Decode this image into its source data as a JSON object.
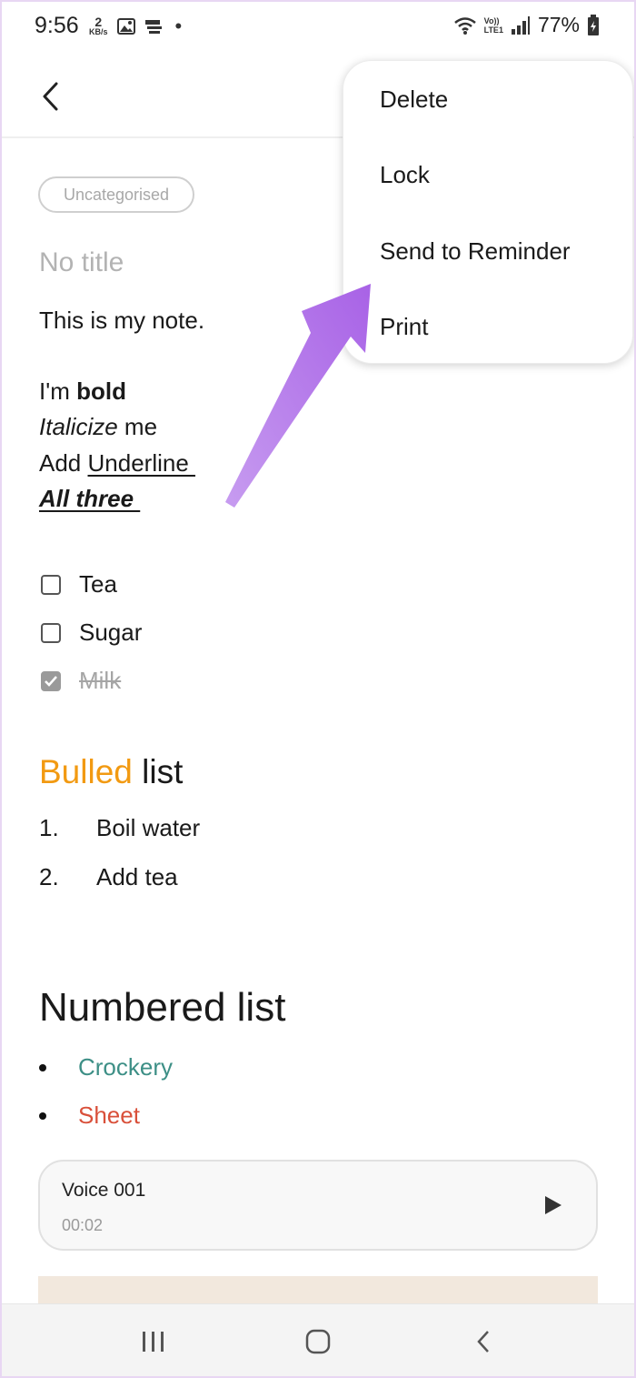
{
  "status_bar": {
    "time": "9:56",
    "data_speed_value": "2",
    "data_speed_unit": "KB/s",
    "battery": "77%",
    "network_label_top": "Vo))",
    "network_label_bottom": "LTE1"
  },
  "note": {
    "category": "Uncategorised",
    "title_placeholder": "No title",
    "body_line": "This is my note.",
    "format_lines": {
      "bold_prefix": "I'm ",
      "bold_word": "bold",
      "italic_word": "Italicize",
      "italic_suffix": " me",
      "underline_prefix": "Add ",
      "underline_word": "Underline ",
      "all_three": "All three "
    },
    "checklist": [
      {
        "label": "Tea",
        "checked": false
      },
      {
        "label": "Sugar",
        "checked": false
      },
      {
        "label": "Milk",
        "checked": true
      }
    ],
    "bulled_heading": {
      "colored": "Bulled",
      "plain": " list",
      "color": "#f29a12"
    },
    "numbered_items": [
      {
        "num": "1.",
        "label": "Boil water"
      },
      {
        "num": "2.",
        "label": "Add tea"
      }
    ],
    "numbered_heading": "Numbered list",
    "bullet_items": [
      {
        "label": "Crockery",
        "color": "#3d8f86"
      },
      {
        "label": "Sheet",
        "color": "#d9503a"
      }
    ],
    "voice": {
      "name": "Voice 001",
      "duration": "00:02"
    }
  },
  "menu": {
    "items": [
      "Delete",
      "Lock",
      "Send to Reminder",
      "Print"
    ]
  },
  "annotation_color": "#b57ae8",
  "icons": [
    "back-icon",
    "play-icon",
    "recent-apps-icon",
    "home-icon",
    "nav-back-icon",
    "wifi-icon",
    "signal-icon",
    "battery-icon",
    "image-icon",
    "notification-icon"
  ]
}
